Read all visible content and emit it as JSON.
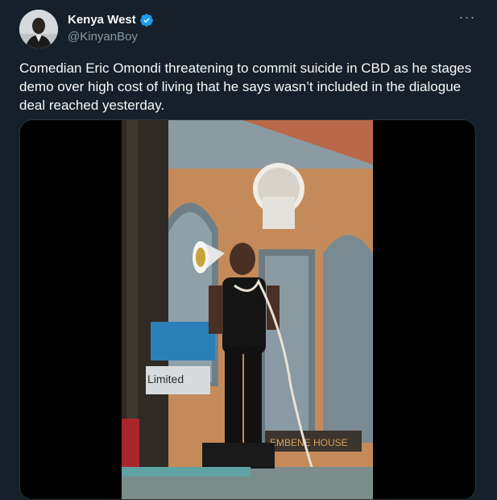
{
  "author": {
    "display_name": "Kenya West",
    "handle": "@KinyanBoy",
    "verified": true,
    "verified_color": "#1d9bf0"
  },
  "more_menu": {
    "icon": "more-horizontal-icon",
    "glyph": "···"
  },
  "tweet": {
    "text": "Comedian Eric Omondi threatening to commit suicide in CBD as he stages demo over high cost of living that he says wasn’t included in the dialogue deal reached yesterday."
  },
  "media": {
    "kind": "video",
    "building_sign_text": "Limited",
    "building_sign_text_2": "EMBENE HOUSE"
  },
  "colors": {
    "background": "#15202b",
    "text_primary": "#f7f9f9",
    "text_secondary": "#8b98a5",
    "border": "#2f3336"
  }
}
